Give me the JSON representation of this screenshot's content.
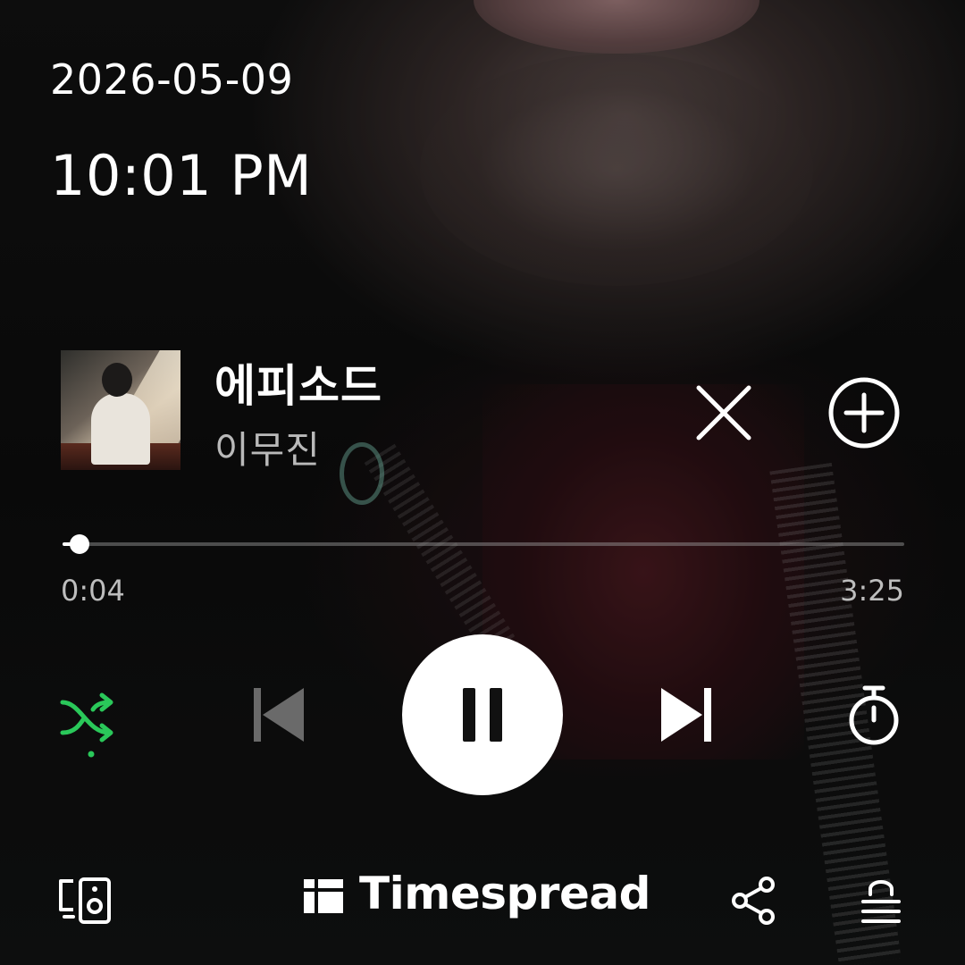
{
  "status": {
    "date": "2026-05-09",
    "time": "10:01 PM"
  },
  "now_playing": {
    "title": "에피소드",
    "artist": "이무진",
    "album_art": "album-cover"
  },
  "progress": {
    "elapsed": "0:04",
    "total": "3:25",
    "fraction": 0.02
  },
  "controls": {
    "shuffle": {
      "icon": "shuffle-icon",
      "active": true,
      "color": "#2ac85a"
    },
    "previous": {
      "icon": "skip-previous-icon",
      "enabled": false
    },
    "play_pause": {
      "icon": "pause-icon",
      "state": "playing"
    },
    "next": {
      "icon": "skip-next-icon",
      "enabled": true
    },
    "timer": {
      "icon": "sleep-timer-icon"
    }
  },
  "actions": {
    "close": {
      "icon": "close-icon"
    },
    "add": {
      "icon": "add-circle-icon"
    }
  },
  "footer": {
    "device_icon": "speaker-device-icon",
    "brand": "Timespread",
    "share_icon": "share-icon",
    "queue_icon": "queue-list-icon"
  },
  "colors": {
    "accent_green": "#2ac85a",
    "text_primary": "#ffffff",
    "text_secondary": "#b9b9b9",
    "disabled": "#6a6a6a"
  }
}
